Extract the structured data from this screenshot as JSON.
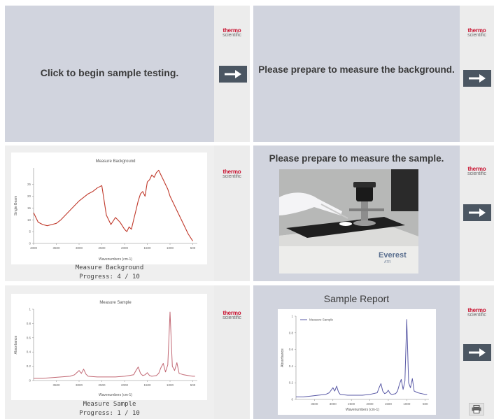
{
  "brand": {
    "line1": "thermo",
    "line2": "scientific"
  },
  "panels": {
    "p1": {
      "prompt": "Click to begin sample testing."
    },
    "p2": {
      "prompt": "Please prepare to measure the background."
    },
    "p3": {
      "caption": "Measure Background",
      "progress_text": "Progress: 4 / 10"
    },
    "p4": {
      "prompt": "Please prepare to measure the sample.",
      "device_label": "Everest",
      "device_sublabel": "ATR"
    },
    "p5": {
      "caption": "Measure Sample",
      "progress_text": "Progress: 1 / 10"
    },
    "p6": {
      "title": "Sample Report"
    }
  },
  "icons": {
    "next": "arrow-right-icon",
    "print": "printer-icon"
  },
  "colors": {
    "background_trace": "#c0392b",
    "sample_trace": "#c26874",
    "report_trace": "#5a5aa6",
    "button": "#4b5662",
    "brand": "#c8102e"
  },
  "chart_data": [
    {
      "type": "line",
      "title": "Measure Background",
      "xlabel": "Wavenumbers (cm-1)",
      "ylabel": "Single Beam",
      "xlim": [
        4000,
        400
      ],
      "ylim": [
        0,
        32
      ],
      "xticks": [
        "4000",
        "3500",
        "3000",
        "2500",
        "2000",
        "1500",
        "1000",
        "500"
      ],
      "yticks": [
        "0",
        "5",
        "10",
        "15",
        "20",
        "25"
      ],
      "series": [
        {
          "x": [
            4000,
            3900,
            3800,
            3700,
            3600,
            3500,
            3400,
            3300,
            3200,
            3100,
            3000,
            2900,
            2800,
            2700,
            2600,
            2500,
            2400,
            2300,
            2200,
            2100,
            2000,
            1950,
            1900,
            1850,
            1800,
            1750,
            1700,
            1650,
            1600,
            1550,
            1500,
            1450,
            1400,
            1350,
            1300,
            1250,
            1200,
            1150,
            1100,
            1050,
            1000,
            900,
            800,
            700,
            600,
            500
          ],
          "y": [
            13,
            9,
            8,
            7.5,
            8,
            8.5,
            10,
            12,
            14,
            16,
            18,
            19.5,
            21,
            22,
            23.5,
            24.5,
            12,
            8,
            11,
            9,
            6,
            5,
            7,
            6,
            10,
            14,
            18,
            21,
            22,
            20,
            26,
            27,
            29,
            28,
            30,
            31,
            29,
            27,
            25,
            23,
            20,
            16,
            12,
            8,
            4,
            1
          ]
        }
      ]
    },
    {
      "type": "line",
      "title": "Measure Sample",
      "xlabel": "Wavenumbers (cm-1)",
      "ylabel": "Absorbance",
      "xlim": [
        4000,
        400
      ],
      "ylim": [
        0,
        1
      ],
      "xticks": [
        "3500",
        "3000",
        "2500",
        "2000",
        "1500",
        "1000",
        "500"
      ],
      "yticks": [
        "0",
        "0.2",
        "0.4",
        "0.6",
        "0.8",
        "1"
      ],
      "series": [
        {
          "x": [
            4000,
            3800,
            3600,
            3400,
            3200,
            3100,
            3000,
            2950,
            2900,
            2850,
            2800,
            2600,
            2400,
            2200,
            2000,
            1900,
            1800,
            1750,
            1700,
            1650,
            1600,
            1550,
            1500,
            1450,
            1400,
            1300,
            1250,
            1200,
            1150,
            1100,
            1050,
            1000,
            950,
            900,
            850,
            800,
            700,
            600,
            500,
            450
          ],
          "y": [
            0.03,
            0.03,
            0.04,
            0.05,
            0.06,
            0.08,
            0.14,
            0.1,
            0.16,
            0.09,
            0.06,
            0.05,
            0.05,
            0.05,
            0.06,
            0.07,
            0.08,
            0.14,
            0.19,
            0.1,
            0.07,
            0.08,
            0.11,
            0.07,
            0.06,
            0.07,
            0.1,
            0.18,
            0.24,
            0.12,
            0.22,
            0.96,
            0.2,
            0.14,
            0.25,
            0.1,
            0.08,
            0.07,
            0.06,
            0.06
          ]
        }
      ]
    },
    {
      "type": "line",
      "title": "Sample Report",
      "xlabel": "Wavenumbers (cm-1)",
      "ylabel": "Absorbance",
      "xlim": [
        4000,
        400
      ],
      "ylim": [
        0,
        1
      ],
      "legend": "top-left",
      "xticks": [
        "3500",
        "3000",
        "2500",
        "2000",
        "1500",
        "1000",
        "500"
      ],
      "yticks": [
        "0",
        "0.2",
        "0.4",
        "0.6",
        "0.8",
        "1"
      ],
      "series": [
        {
          "name": "Measure Sample",
          "x": [
            4000,
            3800,
            3600,
            3400,
            3200,
            3100,
            3000,
            2950,
            2900,
            2850,
            2800,
            2600,
            2400,
            2200,
            2000,
            1900,
            1800,
            1750,
            1700,
            1650,
            1600,
            1550,
            1500,
            1450,
            1400,
            1300,
            1250,
            1200,
            1150,
            1100,
            1050,
            1000,
            950,
            900,
            850,
            800,
            700,
            600,
            500,
            450
          ],
          "y": [
            0.03,
            0.03,
            0.04,
            0.05,
            0.06,
            0.08,
            0.14,
            0.1,
            0.16,
            0.09,
            0.06,
            0.05,
            0.05,
            0.05,
            0.06,
            0.07,
            0.08,
            0.14,
            0.19,
            0.1,
            0.07,
            0.08,
            0.11,
            0.07,
            0.06,
            0.07,
            0.1,
            0.18,
            0.24,
            0.12,
            0.22,
            0.96,
            0.2,
            0.14,
            0.25,
            0.1,
            0.08,
            0.07,
            0.06,
            0.06
          ]
        }
      ]
    }
  ]
}
